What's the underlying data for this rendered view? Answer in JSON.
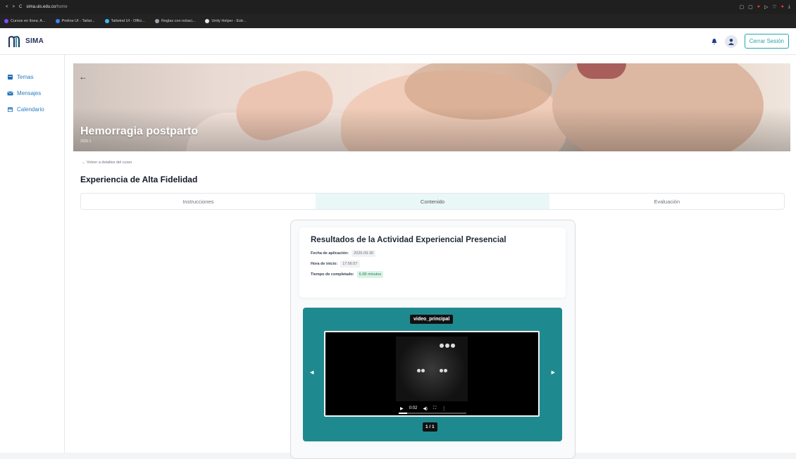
{
  "browser": {
    "url_domain": "sima.uis.edu.co",
    "url_path": "/home",
    "bookmarks": [
      "Cursos en línea: A...",
      "Preline UI - Tailwi...",
      "Tailwind UI - Offici...",
      "Reglas con notaci...",
      "Unity Helper - Estr..."
    ]
  },
  "header": {
    "app_name": "SIMA",
    "logout_label": "Cerrar Sesión"
  },
  "sidebar": {
    "items": [
      {
        "label": "Temas",
        "icon": "book-icon"
      },
      {
        "label": "Mensajes",
        "icon": "envelope-icon"
      },
      {
        "label": "Calendario",
        "icon": "calendar-icon"
      }
    ]
  },
  "banner": {
    "title": "Hemorragia postparto",
    "subtitle": "2025-1"
  },
  "main": {
    "back_link": "← Volver a detalles del curso",
    "section_title": "Experiencia de Alta Fidelidad",
    "tabs": [
      {
        "label": "Instrucciones",
        "active": false
      },
      {
        "label": "Contenido",
        "active": true
      },
      {
        "label": "Evaluación",
        "active": false
      }
    ]
  },
  "results": {
    "title": "Resultados de la Actividad Experiencial Presencial",
    "fecha_label": "Fecha de aplicación:",
    "fecha_value": "2025-09-30",
    "hora_label": "Hora de inicio:",
    "hora_value": "17:56:57",
    "tiempo_label": "Tiempo de completado:",
    "tiempo_value": "6.08 minutos"
  },
  "player": {
    "video_name": "video_principal",
    "time": "0:02",
    "page_indicator": "1 / 1",
    "progress": 0.12
  },
  "colors": {
    "accent": "#2aa4a8",
    "player_bg": "#1e8a90",
    "link_blue": "#2a7cc7"
  }
}
